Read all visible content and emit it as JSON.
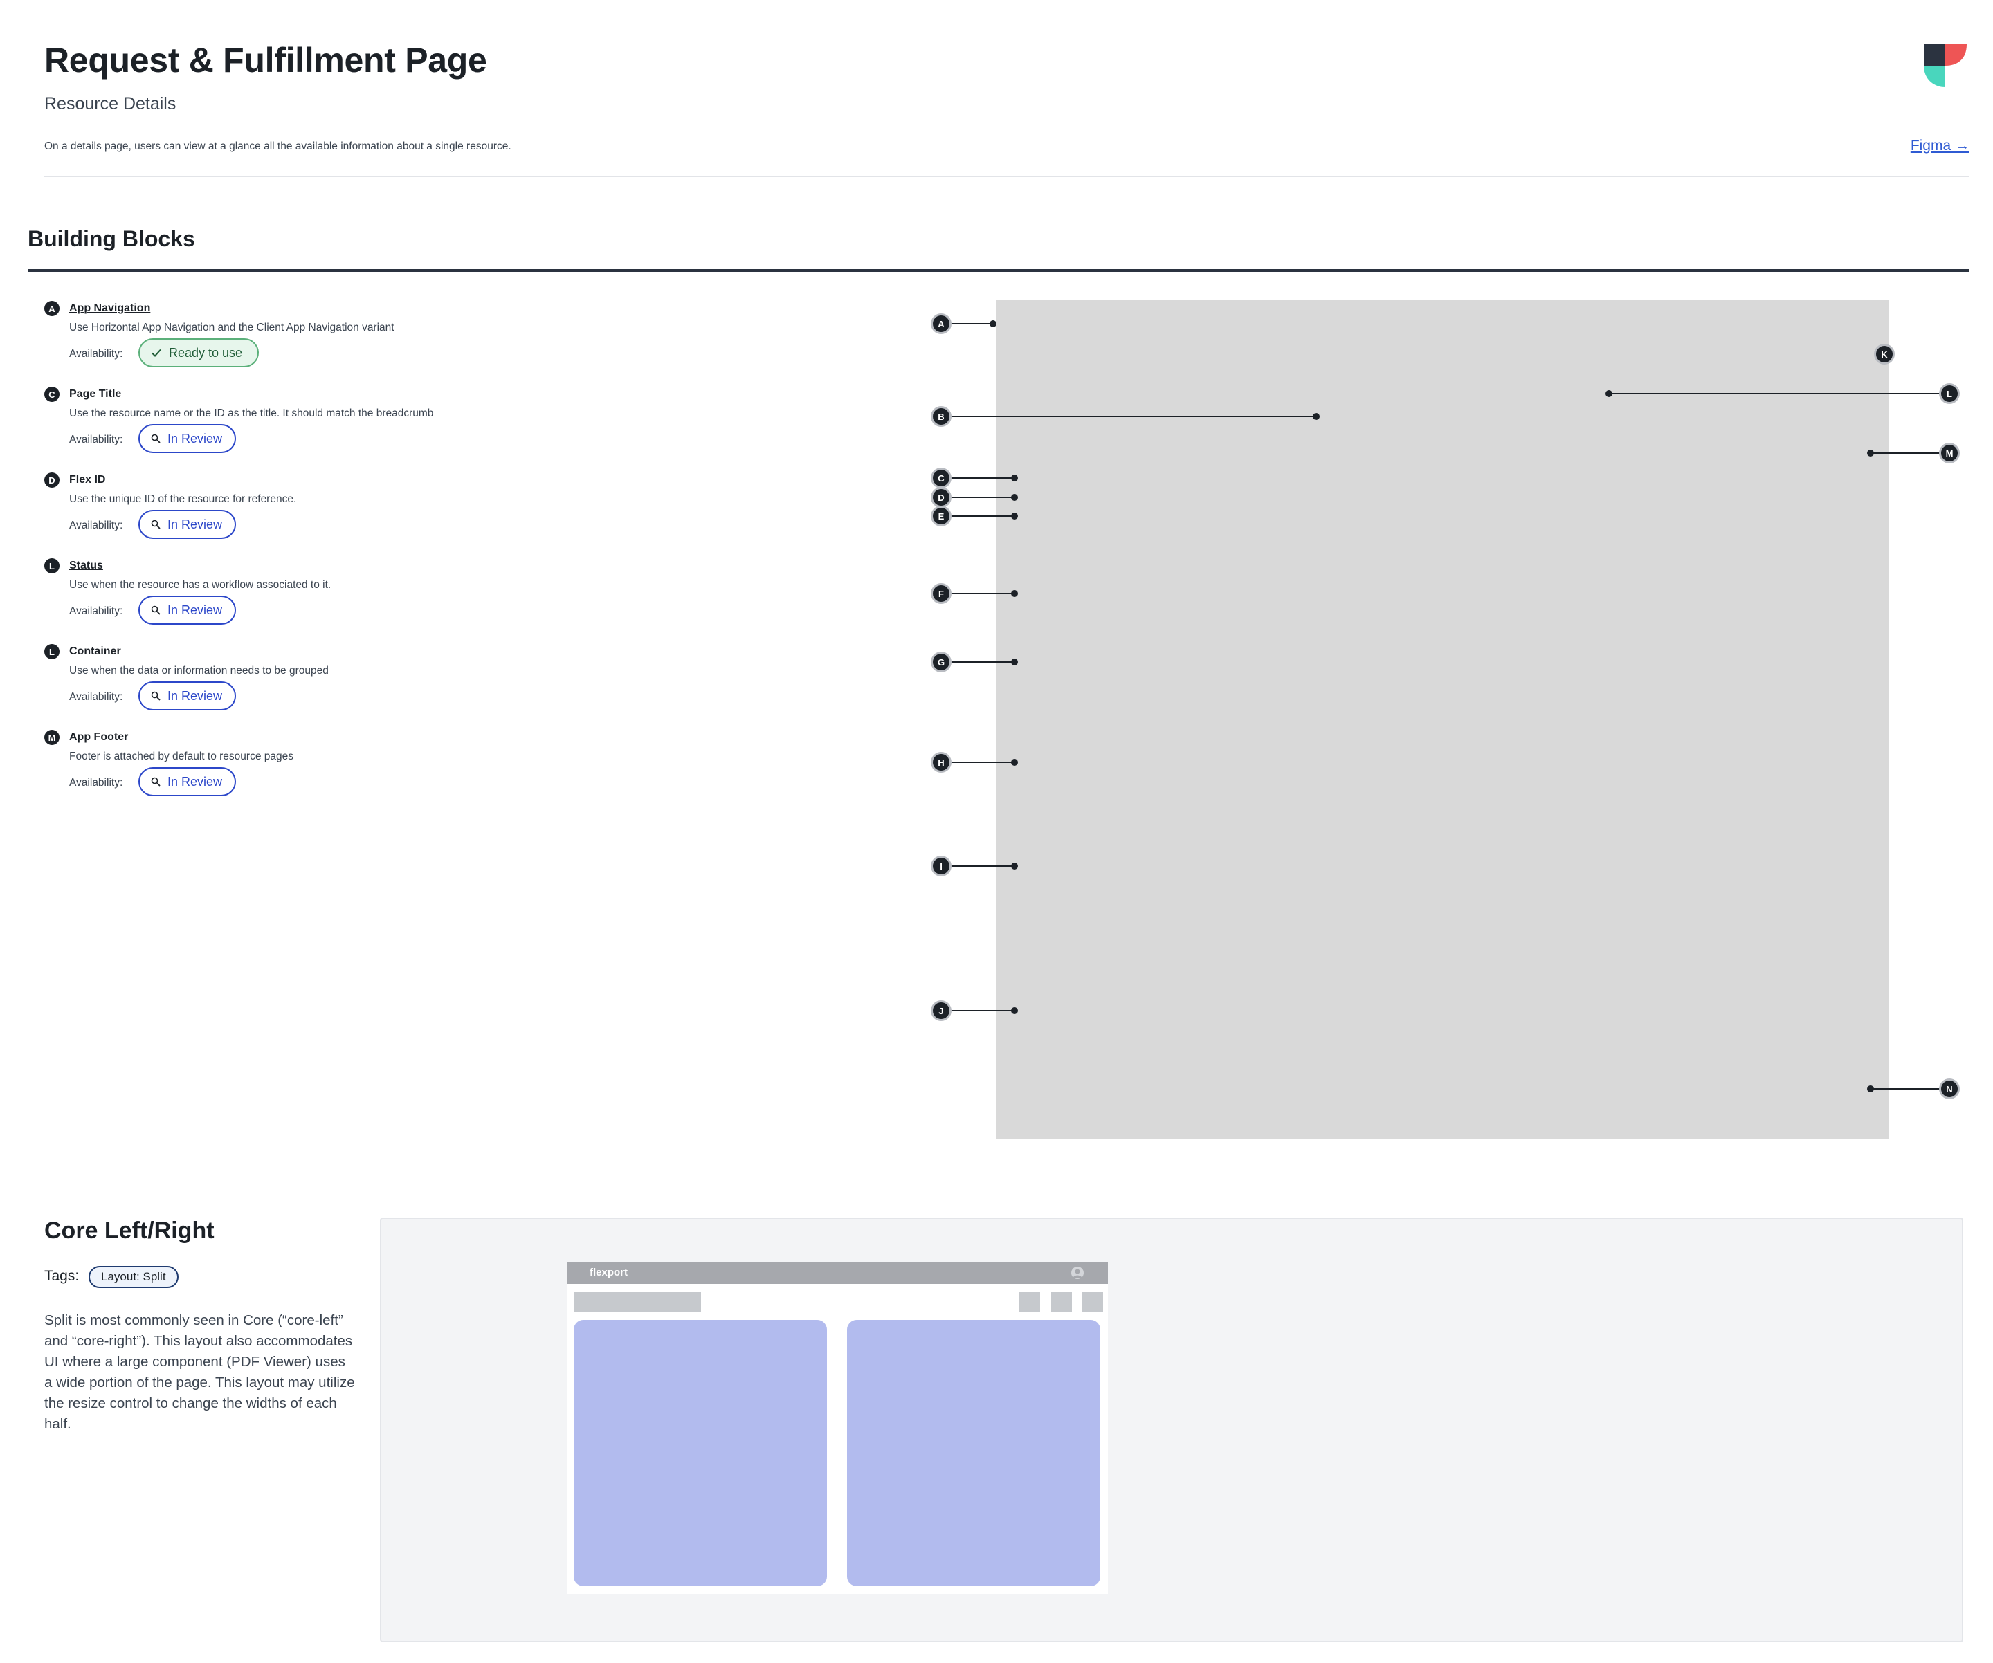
{
  "header": {
    "title": "Request & Fulfillment Page",
    "subtitle": "Resource Details",
    "description": "On a details page, users can view at a glance all the available information about a single resource.",
    "figma_link": "Figma →",
    "brand_colors": [
      "#2b3340",
      "#ee5555",
      "#49d6bd"
    ]
  },
  "building_blocks": {
    "title": "Building Blocks",
    "availability_label": "Availability:",
    "items": [
      {
        "badge": "A",
        "name": "App Navigation",
        "description": "Use Horizontal App Navigation and the Client App Navigation variant",
        "status": "Ready to use",
        "status_icon": "check-icon"
      },
      {
        "badge": "C",
        "name": "Page Title",
        "description": "Use the resource name or the ID as the title. It should match the breadcrumb",
        "status": "In Review",
        "status_icon": "search-icon"
      },
      {
        "badge": "D",
        "name": "Flex ID",
        "description": "Use the unique ID of the resource for reference.",
        "status": "In Review",
        "status_icon": "search-icon"
      },
      {
        "badge": "L",
        "name": "Status",
        "description": "Use when the resource has a workflow associated to it.",
        "status": "In Review",
        "status_icon": "search-icon"
      },
      {
        "badge": "L",
        "name": "Container",
        "description": "Use when the data or information needs to be grouped",
        "status": "In Review",
        "status_icon": "search-icon"
      },
      {
        "badge": "M",
        "name": "App Footer",
        "description": "Footer is attached by default to resource pages",
        "status": "In Review",
        "status_icon": "search-icon"
      }
    ],
    "callouts": [
      "A",
      "B",
      "C",
      "D",
      "E",
      "F",
      "G",
      "H",
      "I",
      "J",
      "K",
      "L",
      "M",
      "N"
    ]
  },
  "core": {
    "title": "Core Left/Right",
    "tags_label": "Tags:",
    "tag": "Layout: Split",
    "description": "Split is most commonly seen in Core (“core-left” and “core-right”). This layout also accommodates UI where a large component (PDF Viewer) uses a wide portion of the page. This layout may utilize the resize control to change the widths of each half.",
    "mock": {
      "brand": "flexport",
      "card_color": "#b2bbee"
    }
  }
}
